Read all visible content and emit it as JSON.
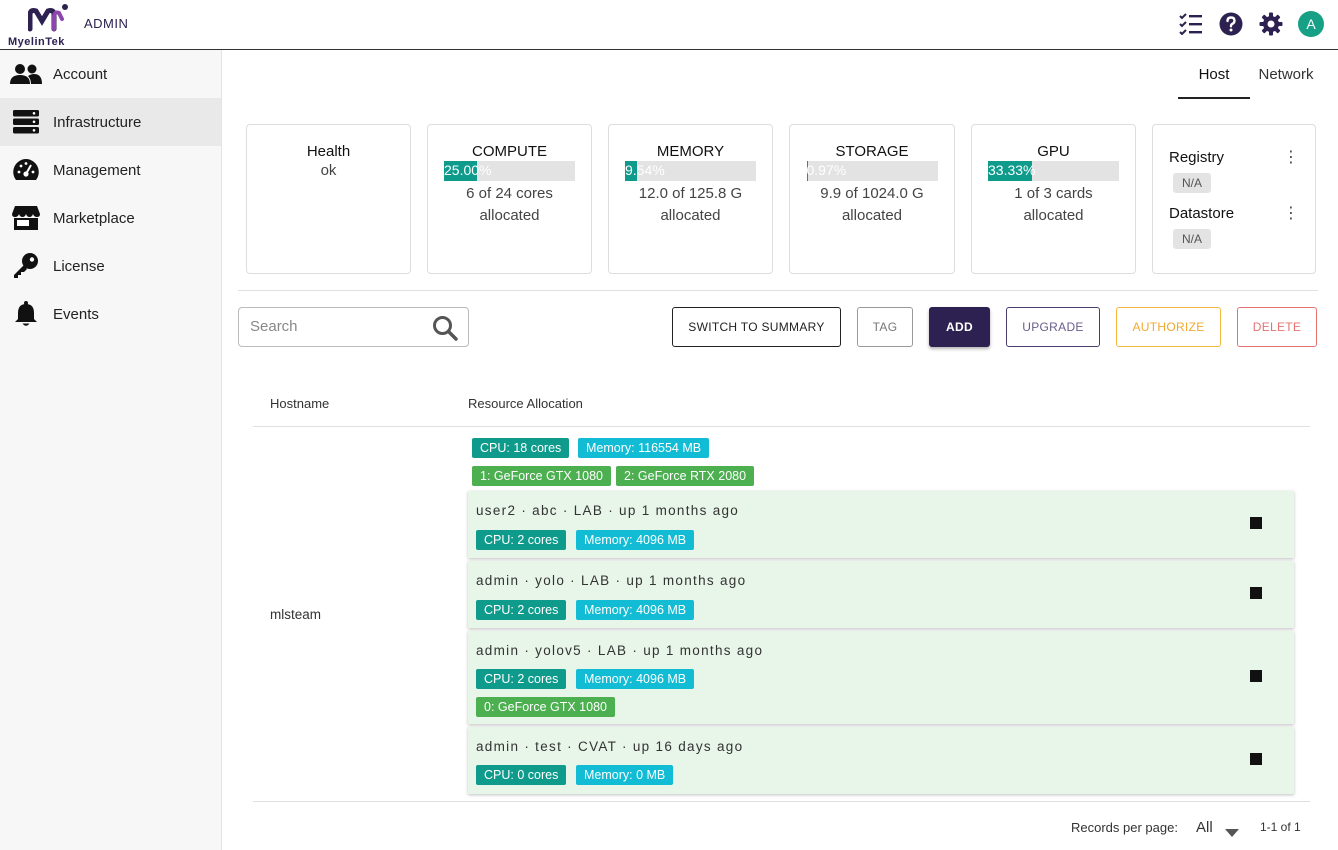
{
  "header": {
    "logo_text": "MyelinTek",
    "admin_label": "ADMIN",
    "icons": [
      "checklist-icon",
      "help-icon",
      "settings-icon"
    ],
    "avatar": "A",
    "colors": {
      "brand": "#2c2150",
      "avatar": "#16a085"
    }
  },
  "sidebar": {
    "items": [
      {
        "label": "Account",
        "icon": "users-icon"
      },
      {
        "label": "Infrastructure",
        "icon": "server-icon",
        "active": true
      },
      {
        "label": "Management",
        "icon": "dashboard-gauge-icon"
      },
      {
        "label": "Marketplace",
        "icon": "store-icon"
      },
      {
        "label": "License",
        "icon": "key-icon"
      },
      {
        "label": "Events",
        "icon": "bell-icon"
      }
    ]
  },
  "tabs": [
    {
      "label": "Host",
      "active": true
    },
    {
      "label": "Network"
    }
  ],
  "summary": {
    "health": {
      "title": "Health",
      "value": "ok"
    },
    "compute": {
      "title": "COMPUTE",
      "percent_text": "25.00%",
      "fill": 0.25,
      "line1": "6 of 24 cores",
      "line2": "allocated"
    },
    "memory": {
      "title": "MEMORY",
      "percent_text": "9.54%",
      "fill": 0.0954,
      "line1": "12.0 of 125.8 G",
      "line2": "allocated"
    },
    "storage": {
      "title": "STORAGE",
      "percent_text": "0.97%",
      "fill": 0.0097,
      "line1": "9.9 of 1024.0 G",
      "line2": "allocated"
    },
    "gpu": {
      "title": "GPU",
      "percent_text": "33.33%",
      "fill": 0.3333,
      "line1": "1 of 3 cards",
      "line2": "allocated"
    },
    "registry": {
      "label": "Registry",
      "value": "N/A"
    },
    "datastore": {
      "label": "Datastore",
      "value": "N/A"
    },
    "bar_color": "#0e9b8c"
  },
  "toolbar": {
    "search_placeholder": "Search",
    "switch_label": "SWITCH TO SUMMARY",
    "tag_label": "TAG",
    "add_label": "ADD",
    "upgrade_label": "UPGRADE",
    "authorize_label": "AUTHORIZE",
    "delete_label": "DELETE"
  },
  "table": {
    "columns": [
      "Hostname",
      "Resource Allocation"
    ],
    "row": {
      "hostname": "mlsteam",
      "host_chips": [
        "CPU: 18 cores",
        "Memory: 116554 MB",
        "1: GeForce GTX 1080",
        "2: GeForce RTX 2080"
      ],
      "workloads": [
        {
          "title": "user2 · abc · LAB · up 1 months ago",
          "cpu": "CPU: 2 cores",
          "memory": "Memory: 4096 MB"
        },
        {
          "title": "admin · yolo · LAB · up 1 months ago",
          "cpu": "CPU: 2 cores",
          "memory": "Memory: 4096 MB"
        },
        {
          "title": "admin · yolov5 · LAB · up 1 months ago",
          "cpu": "CPU: 2 cores",
          "memory": "Memory: 4096 MB",
          "gpu": "0: GeForce GTX 1080"
        },
        {
          "title": "admin · test · CVAT · up 16 days ago",
          "cpu": "CPU: 0 cores",
          "memory": "Memory: 0 MB"
        }
      ]
    }
  },
  "footer": {
    "records_label": "Records per page:",
    "records_value": "All",
    "range": "1-1 of 1"
  }
}
